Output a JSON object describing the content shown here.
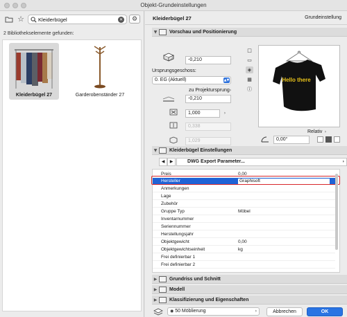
{
  "window": {
    "title": "Objekt-Grundeinstellungen"
  },
  "search": {
    "value": "Kleiderbügel",
    "placeholder": ""
  },
  "results": {
    "count_text": "2 Bibliothekselemente gefunden:",
    "items": [
      {
        "name": "Kleiderbügel 27",
        "selected": true
      },
      {
        "name": "Garderobenständer 27",
        "selected": false
      }
    ]
  },
  "header": {
    "title": "Kleiderbügel 27",
    "mode": "Grundeinstellung"
  },
  "preview_section": {
    "title": "Vorschau und Positionierung",
    "height_value": "-0,210",
    "story_label": "Ursprungsgeschoss:",
    "story_value": "0. EG (Aktuell)",
    "relative_label": "zu Projektursprung",
    "relative_value": "-0,210",
    "scale_x": "1,000",
    "scale_y": "0,338",
    "scale_z": "1,029",
    "view_mode_label": "Relativ",
    "angle_value": "0,00°",
    "shirt_text": "Hello there"
  },
  "params_section": {
    "title": "Kleiderbügel Einstellungen",
    "nav_label": "DWG Export Parameter...",
    "rows": [
      {
        "name": "Preis",
        "value": "0,00"
      },
      {
        "name": "Hersteller",
        "value": "Graphisoft"
      },
      {
        "name": "Anmerkungen",
        "value": ""
      },
      {
        "name": "Lage",
        "value": ""
      },
      {
        "name": "Zubehör",
        "value": ""
      },
      {
        "name": "Gruppe Typ",
        "value": "Möbel"
      },
      {
        "name": "Inventarnummer",
        "value": ""
      },
      {
        "name": "Seriennummer",
        "value": ""
      },
      {
        "name": "Herstellungsjahr",
        "value": ""
      },
      {
        "name": "Objektgewicht",
        "value": "0,00"
      },
      {
        "name": "Objektgewichtseinheit",
        "value": "kg"
      },
      {
        "name": "Frei definierbar 1",
        "value": ""
      },
      {
        "name": "Frei definierbar 2",
        "value": ""
      }
    ]
  },
  "collapsed_sections": [
    "Grundriss und Schnitt",
    "Modell",
    "Klassifizierung und Eigenschaften"
  ],
  "footer": {
    "layer": "50 Möblierung",
    "cancel_label": "Abbrechen",
    "ok_label": "OK"
  },
  "colors": {
    "accent": "#2a74e3",
    "selection": "#1f63d6",
    "highlight": "#d7262a"
  }
}
